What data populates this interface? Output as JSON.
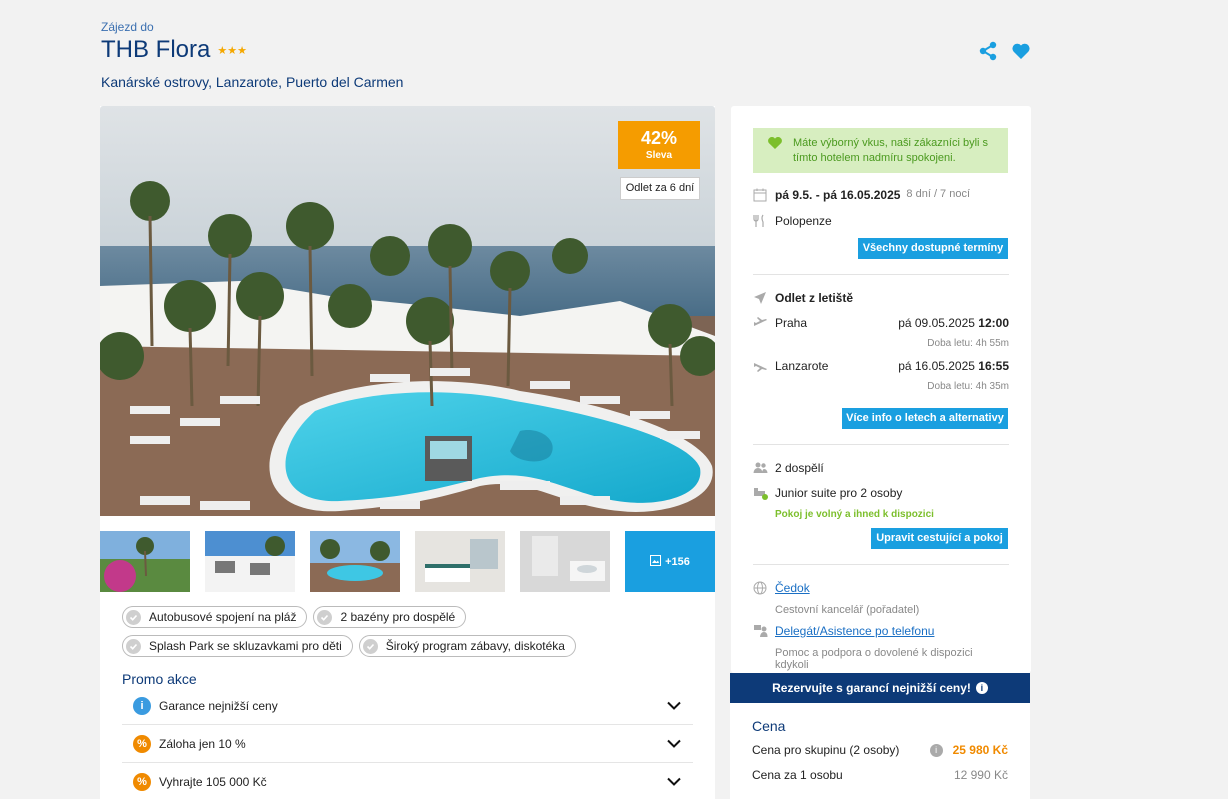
{
  "header": {
    "sub_label": "Zájezd do",
    "hotel_name": "THB Flora",
    "stars": "★★★",
    "location": "Kanárské ostrovy, Lanzarote, Puerto del Carmen"
  },
  "photo": {
    "discount_pct": "42%",
    "discount_label": "Sleva",
    "departure_tag": "Odlet za 6 dní",
    "more_photos": "+156"
  },
  "features": [
    "Autobusové spojení na pláž",
    "2 bazény pro dospělé",
    "Splash Park se skluzavkami pro děti",
    "Široký program zábavy, diskotéka"
  ],
  "promo": {
    "title": "Promo akce",
    "items": [
      {
        "label": "Garance nejnižší ceny",
        "icon": "info-icon",
        "color": "#3a9be0"
      },
      {
        "label": "Záloha jen 10 %",
        "icon": "percent-icon",
        "color": "#f08a00"
      },
      {
        "label": "Vyhrajte 105 000 Kč",
        "icon": "percent-icon",
        "color": "#f08a00"
      }
    ]
  },
  "summary": {
    "taste_message": "Máte výborný vkus, naši zákazníci byli s tímto hotelem nadmíru spokojeni.",
    "dates": "pá 9.5. - pá 16.05.2025",
    "duration": "8 dní / 7 nocí",
    "board": "Polopenze",
    "all_dates_button": "Všechny dostupné termíny",
    "departure_airport_label": "Odlet z letiště",
    "flight_out": {
      "city": "Praha",
      "date": "pá 09.05.2025",
      "time": "12:00",
      "duration": "Doba letu: 4h 55m"
    },
    "flight_back": {
      "city": "Lanzarote",
      "date": "pá 16.05.2025",
      "time": "16:55",
      "duration": "Doba letu: 4h 35m"
    },
    "flight_info_button": "Více info o letech a alternativy",
    "travellers": "2 dospělí",
    "room": "Junior suite pro 2 osoby",
    "room_status": "Pokoj je volný a ihned k dispozici",
    "edit_button": "Upravit cestující a pokoj",
    "agency_link": "Čedok",
    "agency_desc": "Cestovní kancelář (pořadatel)",
    "support_link": "Delegát/Asistence po telefonu",
    "support_desc": "Pomoc a podpora o dovolené k dispozici kdykoli"
  },
  "price": {
    "guarantee": "Rezervujte s garancí nejnižší ceny!",
    "title": "Cena",
    "group_label": "Cena pro skupinu (2 osoby)",
    "group_value": "25 980 Kč",
    "person_label": "Cena za 1 osobu",
    "person_value": "12 990 Kč"
  },
  "colors": {
    "accent": "#1a9fe0",
    "brand": "#0d3a78",
    "discount": "#f59c00",
    "success": "#7cbf2c"
  }
}
